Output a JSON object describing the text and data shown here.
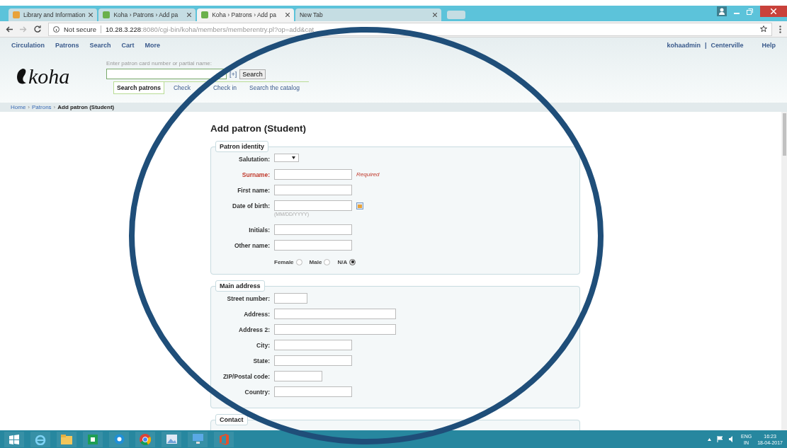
{
  "browser": {
    "tabs": [
      {
        "title": "Library and Information",
        "selected": false
      },
      {
        "title": "Koha › Patrons › Add pa",
        "selected": false
      },
      {
        "title": "Koha › Patrons › Add pa",
        "selected": true
      },
      {
        "title": "New Tab",
        "selected": false
      }
    ],
    "security": "Not secure",
    "url_host": "10.28.3.228",
    "url_rest": ":8080/cgi-bin/koha/members/memberentry.pl?op=add&cat"
  },
  "nav": {
    "items": [
      "Circulation",
      "Patrons",
      "Search",
      "Cart",
      "More"
    ],
    "user": "kohaadmin",
    "separator": "|",
    "branch": "Centerville",
    "help": "Help"
  },
  "logo": "koha",
  "search": {
    "hint": "Enter patron card number or partial name:",
    "plus": "[+]",
    "button": "Search",
    "tabs": [
      {
        "label": "Search patrons",
        "selected": true
      },
      {
        "label": "Check",
        "selected": false
      },
      {
        "label": "Check in",
        "selected": false
      },
      {
        "label": "Search the catalog",
        "selected": false
      }
    ]
  },
  "breadcrumb": [
    {
      "label": "Home",
      "kind": "link"
    },
    {
      "label": "Patrons",
      "kind": "link"
    },
    {
      "label": "Add patron (Student)",
      "kind": "current"
    }
  ],
  "breadcrumb_separator": "›",
  "page_title": "Add patron (Student)",
  "fieldsets": [
    {
      "legend": "Patron identity",
      "fields": [
        {
          "label": "Salutation:",
          "kind": "select",
          "required": false
        },
        {
          "label": "Surname:",
          "kind": "text",
          "required": true,
          "note": "Required"
        },
        {
          "label": "First name:",
          "kind": "text",
          "required": false
        },
        {
          "label": "Date of birth:",
          "kind": "date",
          "required": false,
          "hint": "(MM/DD/YYYY)"
        },
        {
          "label": "Initials:",
          "kind": "text",
          "required": false
        },
        {
          "label": "Other name:",
          "kind": "text",
          "required": false
        },
        {
          "kind": "radios",
          "options": [
            {
              "label": "Female",
              "selected": false
            },
            {
              "label": "Male",
              "selected": false
            },
            {
              "label": "N/A",
              "selected": true
            }
          ]
        }
      ]
    },
    {
      "legend": "Main address",
      "fields": [
        {
          "label": "Street number:",
          "kind": "short_text",
          "required": false
        },
        {
          "label": "Address:",
          "kind": "long_text",
          "required": false
        },
        {
          "label": "Address 2:",
          "kind": "long_text",
          "required": false
        },
        {
          "label": "City:",
          "kind": "text",
          "required": false
        },
        {
          "label": "State:",
          "kind": "text",
          "required": false
        },
        {
          "label": "ZIP/Postal code:",
          "kind": "zip_text",
          "required": false
        },
        {
          "label": "Country:",
          "kind": "text",
          "required": false
        }
      ]
    },
    {
      "legend": "Contact"
    }
  ],
  "tray": {
    "language": "ENG",
    "region": "IN",
    "time": "16:23",
    "date": "18-04-2017"
  }
}
